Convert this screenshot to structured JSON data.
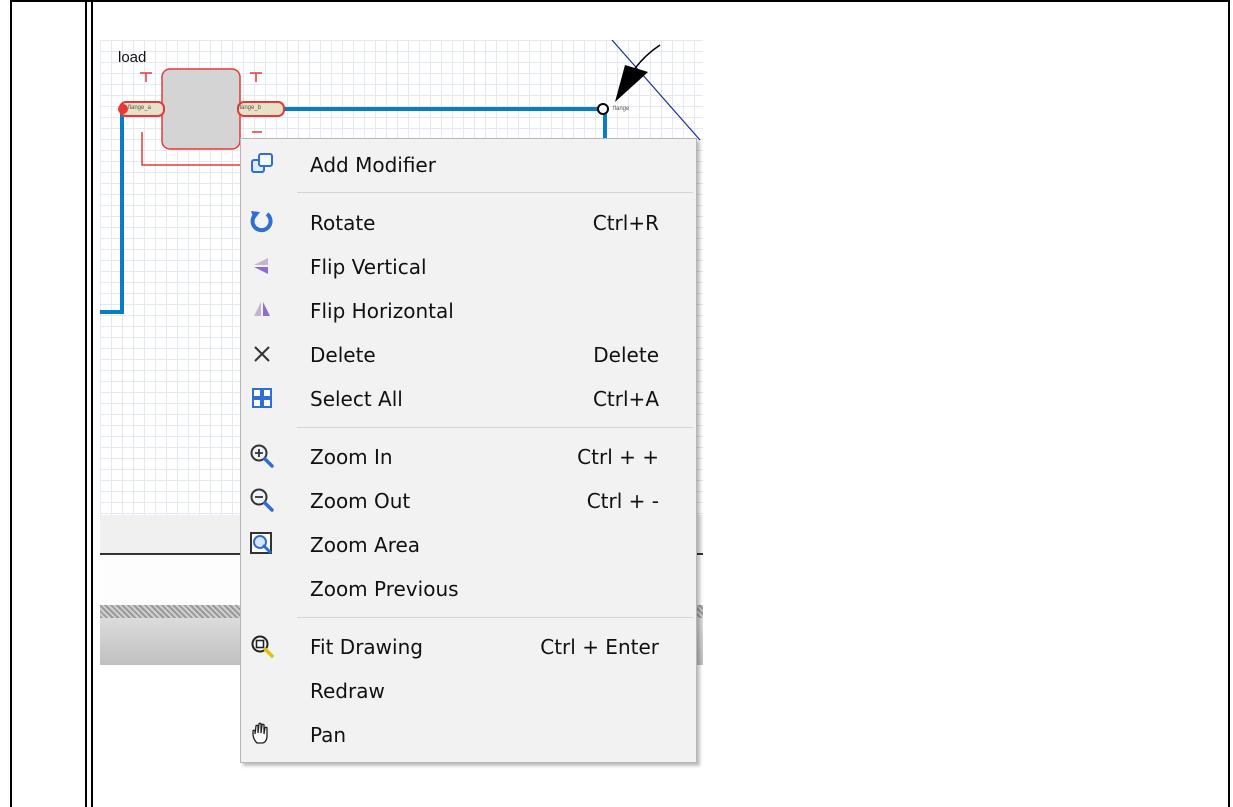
{
  "canvas": {
    "component_label": "load",
    "flange_a": "flange_a",
    "flange_b": "flange_b",
    "flange_right": "flange"
  },
  "context_menu": {
    "items": [
      {
        "label": "Add Modifier",
        "shortcut": "",
        "icon": "add-modifier-icon"
      },
      {
        "label": "Rotate",
        "shortcut": "Ctrl+R",
        "icon": "rotate-icon"
      },
      {
        "label": "Flip Vertical",
        "shortcut": "",
        "icon": "flip-vertical-icon"
      },
      {
        "label": "Flip Horizontal",
        "shortcut": "",
        "icon": "flip-horizontal-icon"
      },
      {
        "label": "Delete",
        "shortcut": "Delete",
        "icon": "close-icon"
      },
      {
        "label": "Select All",
        "shortcut": "Ctrl+A",
        "icon": "select-all-icon"
      },
      {
        "label": "Zoom In",
        "shortcut": "Ctrl + +",
        "icon": "zoom-in-icon"
      },
      {
        "label": "Zoom Out",
        "shortcut": "Ctrl + -",
        "icon": "zoom-out-icon"
      },
      {
        "label": "Zoom Area",
        "shortcut": "",
        "icon": "zoom-area-icon"
      },
      {
        "label": "Zoom Previous",
        "shortcut": "",
        "icon": ""
      },
      {
        "label": "Fit Drawing",
        "shortcut": "Ctrl + Enter",
        "icon": "fit-drawing-icon"
      },
      {
        "label": "Redraw",
        "shortcut": "",
        "icon": ""
      },
      {
        "label": "Pan",
        "shortcut": "",
        "icon": "hand-icon"
      }
    ]
  },
  "colors": {
    "wire": "#0a7bc6",
    "selection": "#e53935",
    "icon_blue": "#2f6fd1",
    "icon_purple": "#8e6bd6",
    "menu_bg": "#f2f2f2"
  }
}
